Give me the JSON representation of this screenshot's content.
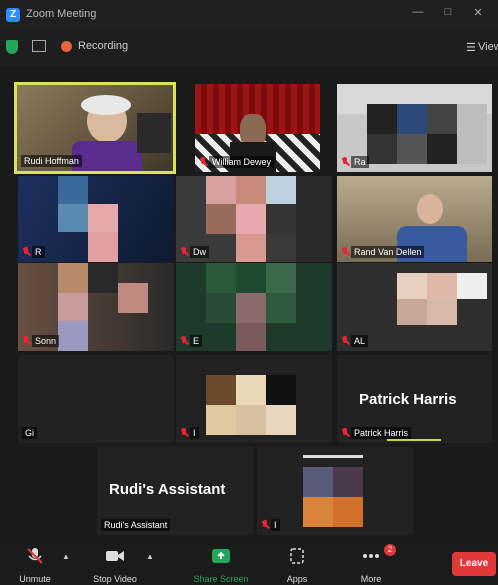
{
  "window": {
    "title": "Zoom Meeting"
  },
  "top_bar": {
    "recording_label": "Recording",
    "view_label": "View"
  },
  "participants": [
    {
      "name": "Rudi Hoffman",
      "active_speaker": true
    },
    {
      "name": "William Dewey"
    },
    {
      "name": "Ra"
    },
    {
      "name": "R"
    },
    {
      "name": "Dw"
    },
    {
      "name": "Rand Van Dellen"
    },
    {
      "name": "Sonn"
    },
    {
      "name": "E"
    },
    {
      "name": "AL"
    },
    {
      "name": "Gi"
    },
    {
      "name": "I"
    },
    {
      "name": "Patrick Harris",
      "display_text": "Patrick Harris"
    },
    {
      "name": "Rudi's Assistant",
      "display_text": "Rudi's Assistant"
    },
    {
      "name": "I"
    }
  ],
  "toolbar": {
    "unmute_label": "Unmute",
    "stop_video_label": "Stop Video",
    "share_screen_label": "Share Screen",
    "apps_label": "Apps",
    "more_label": "More",
    "more_badge": "2",
    "leave_label": "Leave"
  },
  "colors": {
    "accent_green": "#23a55a",
    "leave_red": "#e2383a",
    "active_border": "#d8e25a"
  }
}
